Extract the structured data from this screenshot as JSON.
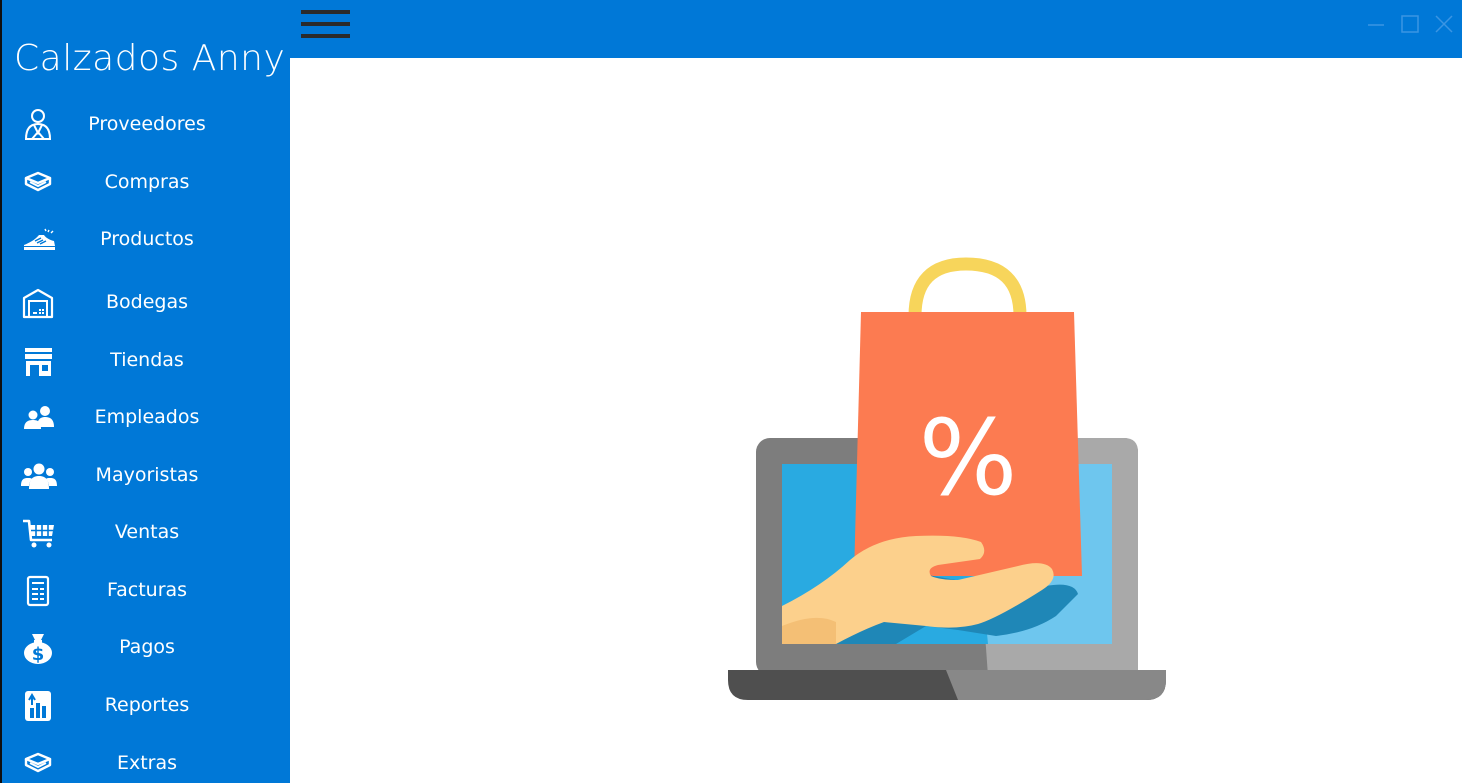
{
  "app": {
    "title": "Calzados Anny"
  },
  "window_controls": {
    "minimize": "minimize-icon",
    "maximize": "maximize-icon",
    "close": "close-icon"
  },
  "sidebar": {
    "items": [
      {
        "label": "Proveedores",
        "icon": "supplier-icon"
      },
      {
        "label": "Compras",
        "icon": "box-icon"
      },
      {
        "label": "Productos",
        "icon": "shoe-icon"
      },
      {
        "label": "Bodegas",
        "icon": "warehouse-icon"
      },
      {
        "label": "Tiendas",
        "icon": "store-icon"
      },
      {
        "label": "Empleados",
        "icon": "employees-icon"
      },
      {
        "label": "Mayoristas",
        "icon": "group-icon"
      },
      {
        "label": "Ventas",
        "icon": "cart-icon"
      },
      {
        "label": "Facturas",
        "icon": "invoice-icon"
      },
      {
        "label": "Pagos",
        "icon": "money-bag-icon"
      },
      {
        "label": "Reportes",
        "icon": "report-chart-icon"
      },
      {
        "label": "Extras",
        "icon": "box-icon"
      }
    ]
  },
  "hero": {
    "symbol": "%"
  },
  "colors": {
    "accent": "#0078d7",
    "hamburger": "#2b2b2b",
    "bag": "#fc7b51",
    "handle": "#f7d55b",
    "screen": "#29aae1",
    "hand": "#fcd08c"
  }
}
